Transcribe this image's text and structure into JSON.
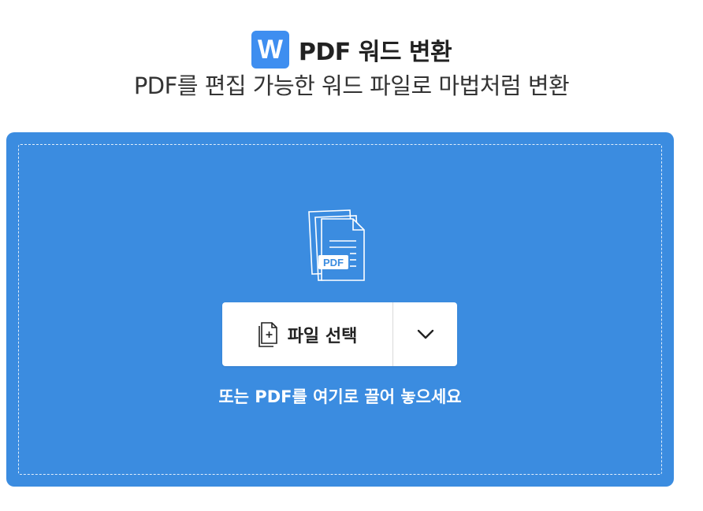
{
  "header": {
    "logo_letter": "W",
    "title": "PDF 워드 변환",
    "subtitle": "PDF를 편집 가능한 워드 파일로 마법처럼 변환"
  },
  "dropzone": {
    "pdf_badge": "PDF",
    "select_button_label": "파일 선택",
    "hint": "또는 PDF를 여기로 끌어 놓으세요"
  },
  "colors": {
    "accent": "#3b8ce0",
    "logo": "#3e8ef0",
    "text": "#222222"
  },
  "icons": {
    "logo": "word-logo-icon",
    "illustration": "pdf-files-icon",
    "select": "file-add-icon",
    "dropdown": "chevron-down-icon"
  }
}
